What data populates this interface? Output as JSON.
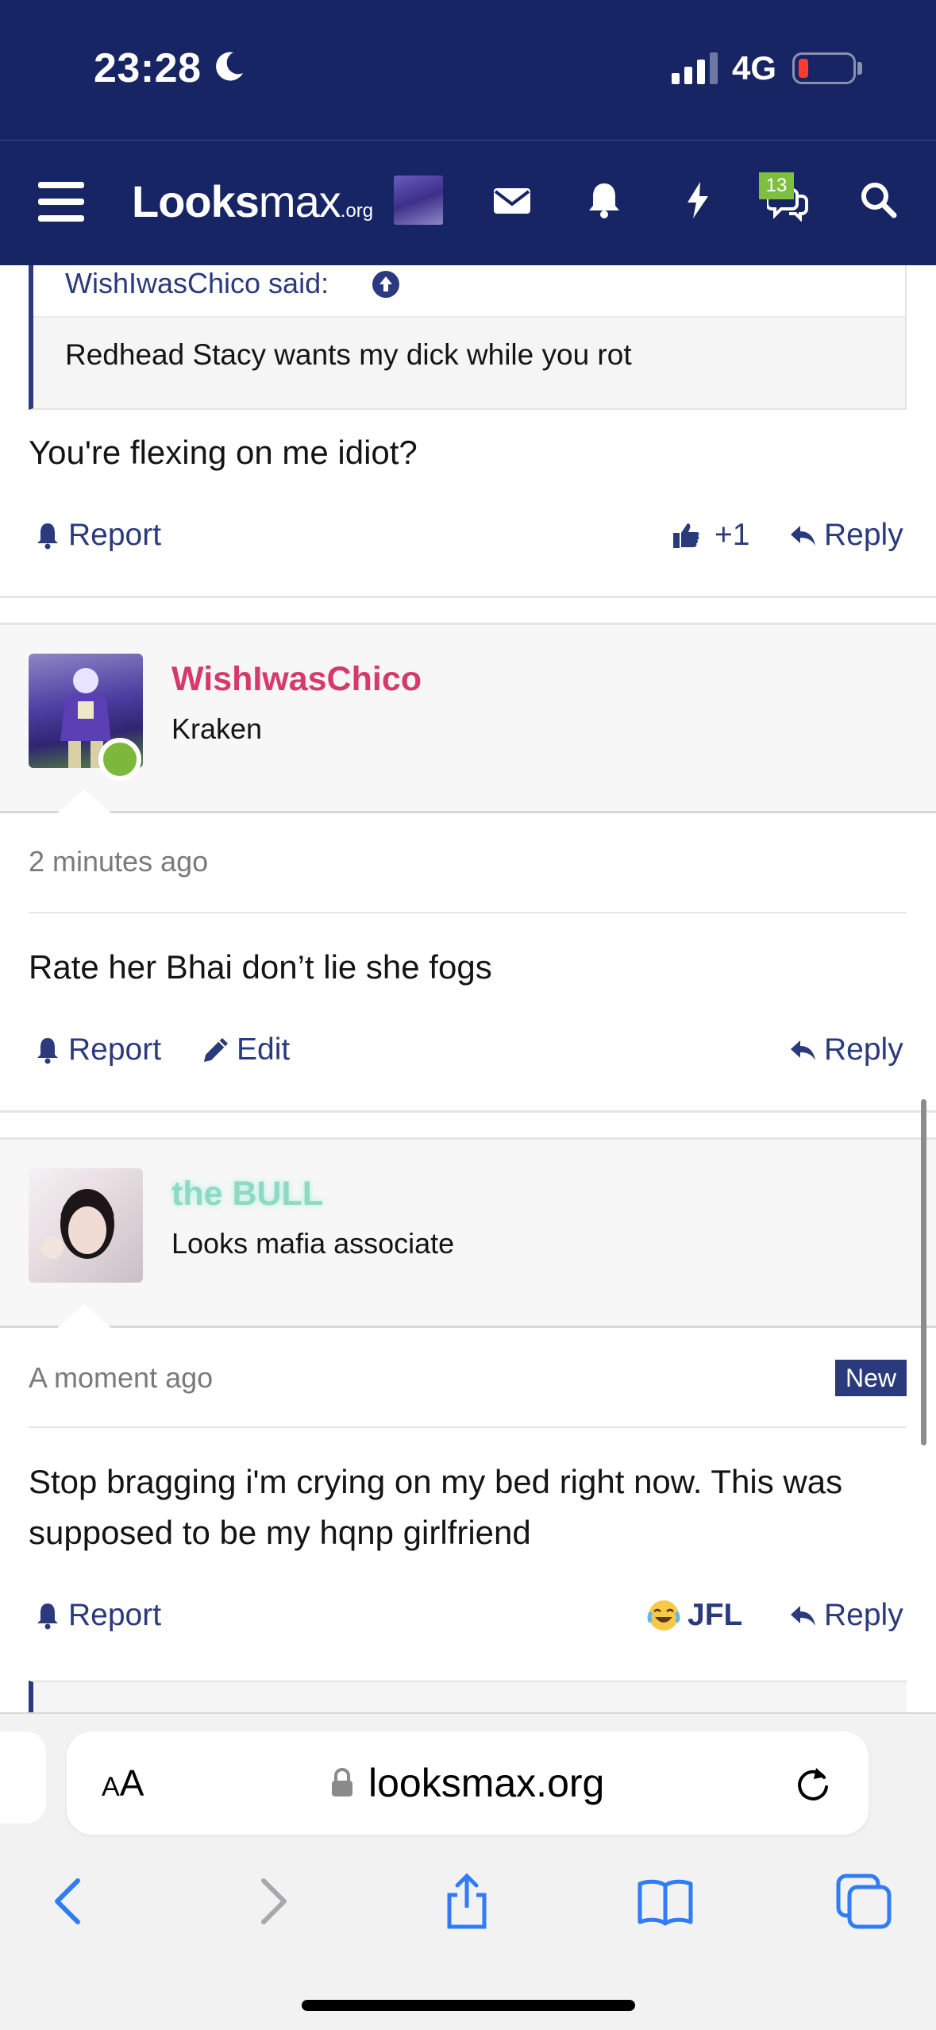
{
  "status_bar": {
    "time": "23:28",
    "network": "4G",
    "icons": [
      "moon-icon",
      "signal-bars-icon",
      "battery-icon"
    ]
  },
  "nav": {
    "logo_main": "Looks",
    "logo_rest": "max",
    "logo_tld": ".org",
    "icons": [
      "hamburger-icon",
      "avatar",
      "envelope-icon",
      "bell-icon",
      "lightning-icon",
      "chat-bubbles-icon",
      "search-icon"
    ],
    "conversations_badge": "13"
  },
  "quote": {
    "author": "WishIwasChico said:",
    "text": "Redhead Stacy wants my dick while you rot"
  },
  "post1": {
    "text": "You're flexing on me idiot?",
    "report": "Report",
    "like_count": "+1",
    "reply": "Reply"
  },
  "post2": {
    "username": "WishIwasChico",
    "username_color": "#d63a6a",
    "user_title": "Kraken",
    "time": "2 minutes ago",
    "text": "Rate her Bhai don’t lie she fogs",
    "report": "Report",
    "edit": "Edit",
    "reply": "Reply"
  },
  "post3": {
    "username": "the BULL",
    "username_color": "#8fd9c4",
    "user_title": "Looks mafia associate",
    "time": "A moment ago",
    "new_badge": "New",
    "text": "Stop bragging i'm crying on my bed right now. This was supposed to be my hqnp girlfriend",
    "report": "Report",
    "reaction": "JFL",
    "reaction_icon": "crying-laughing-emoji",
    "reply": "Reply"
  },
  "safari": {
    "aa_label_small": "A",
    "aa_label_large": "A",
    "url": "looksmax.org",
    "toolbar_icons": [
      "back-icon",
      "forward-icon",
      "share-icon",
      "bookmarks-icon",
      "tabs-icon"
    ]
  },
  "colors": {
    "brand_navy": "#182564",
    "link_blue": "#2a3a7c",
    "online_green": "#7cb83a"
  }
}
